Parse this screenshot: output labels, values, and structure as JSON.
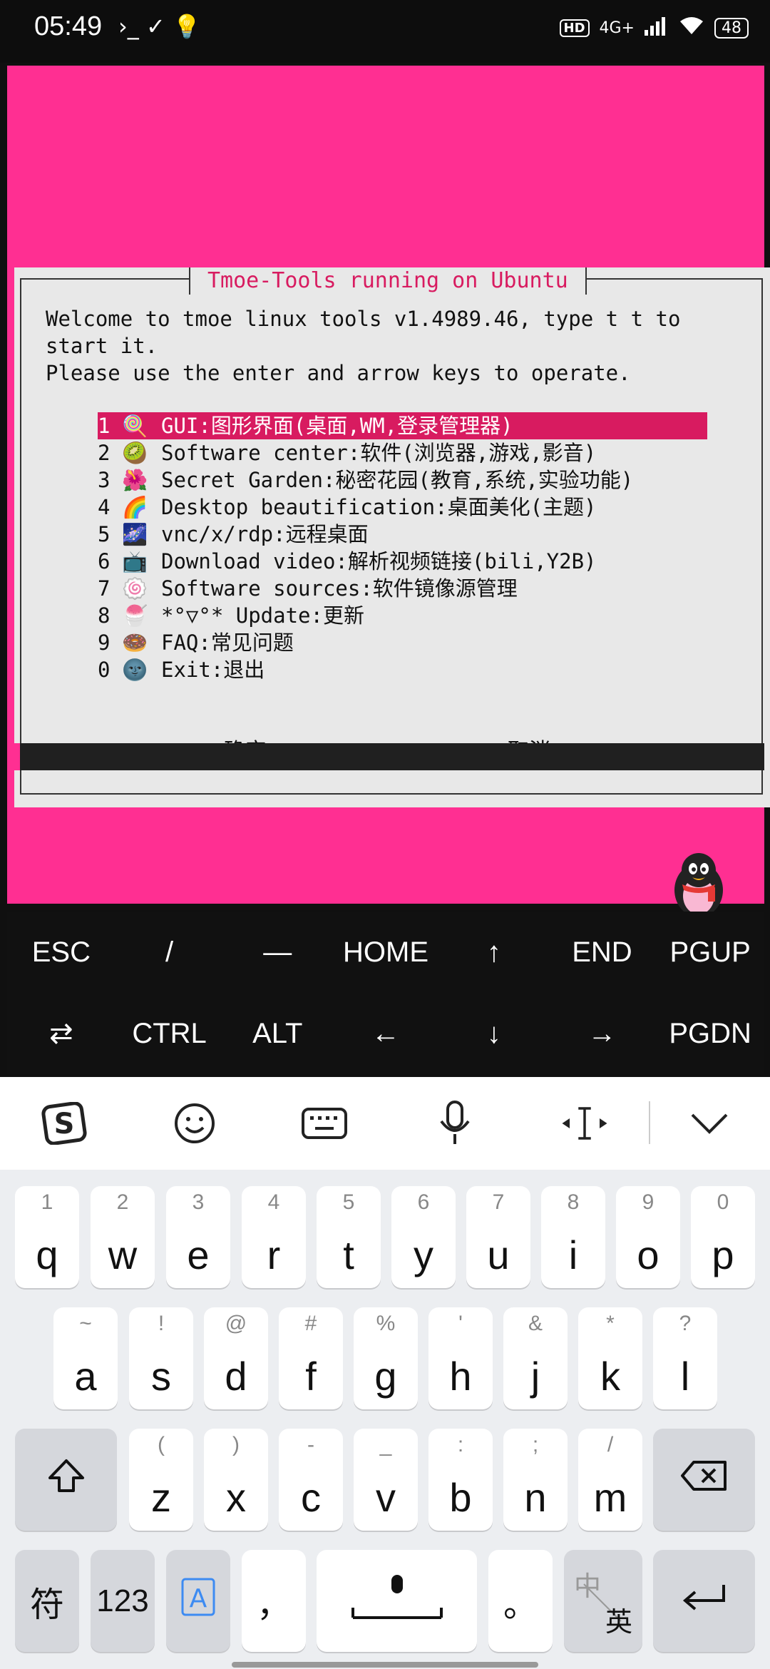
{
  "status_bar": {
    "time": "05:49",
    "notification_glyphs": "›_ ✓ 💡",
    "hd": "HD",
    "network": "4G+",
    "battery": "48"
  },
  "terminal": {
    "dialog_title": "Tmoe-Tools running on Ubuntu",
    "welcome_lines": [
      "Welcome to tmoe linux tools v1.4989.46, type t t to",
      "start it.",
      "Please use the enter and arrow keys to operate."
    ],
    "menu": [
      {
        "num": "1",
        "icon": "🍭",
        "label": "GUI:图形界面(桌面,WM,登录管理器)",
        "selected": true
      },
      {
        "num": "2",
        "icon": "🥝",
        "label": "Software center:软件(浏览器,游戏,影音)"
      },
      {
        "num": "3",
        "icon": "🌺",
        "label": "Secret Garden:秘密花园(教育,系统,实验功能)"
      },
      {
        "num": "4",
        "icon": "🌈",
        "label": "Desktop beautification:桌面美化(主题)"
      },
      {
        "num": "5",
        "icon": "🌌",
        "label": "vnc/x/rdp:远程桌面"
      },
      {
        "num": "6",
        "icon": "📺",
        "label": "Download video:解析视频链接(bili,Y2B)"
      },
      {
        "num": "7",
        "icon": "🍥",
        "label": "Software sources:软件镜像源管理"
      },
      {
        "num": "8",
        "icon": "🍧",
        "label": "*°▽°* Update:更新"
      },
      {
        "num": "9",
        "icon": "🍩",
        "label": "FAQ:常见问题"
      },
      {
        "num": "0",
        "icon": "🌚",
        "label": "Exit:退出"
      }
    ],
    "ok_button": "<确定>",
    "cancel_button": "<取消>"
  },
  "extra_keys": {
    "row1": [
      "ESC",
      "/",
      "—",
      "HOME",
      "↑",
      "END",
      "PGUP"
    ],
    "row2": [
      "⇄",
      "CTRL",
      "ALT",
      "←",
      "↓",
      "→",
      "PGDN"
    ]
  },
  "keyboard": {
    "row1": [
      {
        "sub": "1",
        "main": "q"
      },
      {
        "sub": "2",
        "main": "w"
      },
      {
        "sub": "3",
        "main": "e"
      },
      {
        "sub": "4",
        "main": "r"
      },
      {
        "sub": "5",
        "main": "t"
      },
      {
        "sub": "6",
        "main": "y"
      },
      {
        "sub": "7",
        "main": "u"
      },
      {
        "sub": "8",
        "main": "i"
      },
      {
        "sub": "9",
        "main": "o"
      },
      {
        "sub": "0",
        "main": "p"
      }
    ],
    "row2": [
      {
        "sub": "~",
        "main": "a"
      },
      {
        "sub": "!",
        "main": "s"
      },
      {
        "sub": "@",
        "main": "d"
      },
      {
        "sub": "#",
        "main": "f"
      },
      {
        "sub": "%",
        "main": "g"
      },
      {
        "sub": "'",
        "main": "h"
      },
      {
        "sub": "&",
        "main": "j"
      },
      {
        "sub": "*",
        "main": "k"
      },
      {
        "sub": "?",
        "main": "l"
      }
    ],
    "row3": [
      {
        "sub": "(",
        "main": "z"
      },
      {
        "sub": ")",
        "main": "x"
      },
      {
        "sub": "-",
        "main": "c"
      },
      {
        "sub": "_",
        "main": "v"
      },
      {
        "sub": ":",
        "main": "b"
      },
      {
        "sub": ";",
        "main": "n"
      },
      {
        "sub": "/",
        "main": "m"
      }
    ],
    "symbol_key": "符",
    "number_key": "123",
    "comma_key": "，",
    "period_key": "。",
    "lang_top": "中",
    "lang_bottom": "英"
  }
}
